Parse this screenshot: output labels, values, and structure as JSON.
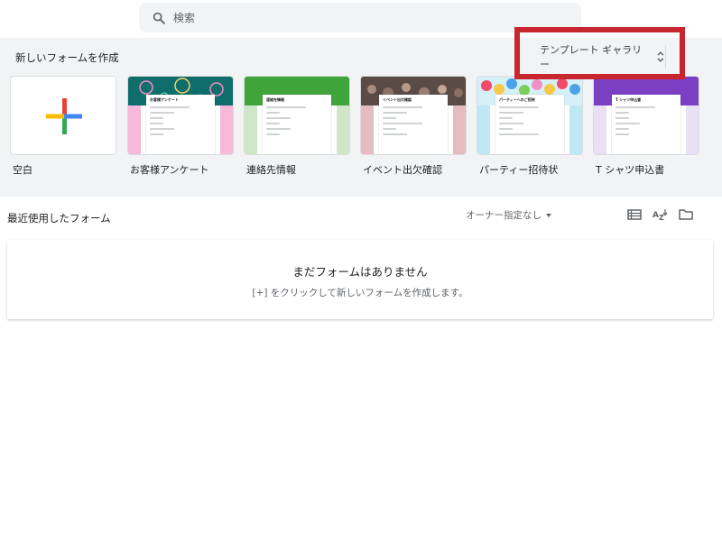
{
  "search": {
    "placeholder": "検索"
  },
  "templates": {
    "section_title": "新しいフォームを作成",
    "gallery_button": "テンプレート ギャラリー",
    "items": [
      {
        "label": "空白"
      },
      {
        "label": "お客様アンケート",
        "form_title": "お客様アンケート",
        "accent": "#f5b5d8",
        "banner": "#0f6e6b"
      },
      {
        "label": "連絡先情報",
        "form_title": "連絡先情報",
        "accent": "#cfe7c8",
        "banner": "#3fa43a"
      },
      {
        "label": "イベント出欠確認",
        "form_title": "イベント出欠確認",
        "accent": "#e4bcc0",
        "banner": "#6b5a55"
      },
      {
        "label": "パーティー招待状",
        "form_title": "パーティーへのご招待",
        "accent": "#bfe8f5",
        "banner": "#f7c948"
      },
      {
        "label": "T シャツ申込書",
        "form_title": "T シャツ申込書",
        "accent": "#e9e0f3",
        "banner": "#7b3fc4"
      }
    ]
  },
  "recent": {
    "title": "最近使用したフォーム",
    "owner_filter": "オーナー指定なし",
    "empty_title": "まだフォームはありません",
    "empty_subtitle": "[+] をクリックして新しいフォームを作成します。"
  },
  "icons": {
    "search": "search-icon",
    "sort_arrows": "unfold-icon",
    "list_view": "list-view-icon",
    "sort": "sort-az-icon",
    "folder": "folder-icon"
  },
  "colors": {
    "highlight": "#c8262f",
    "band_background": "#f1f3f4"
  }
}
